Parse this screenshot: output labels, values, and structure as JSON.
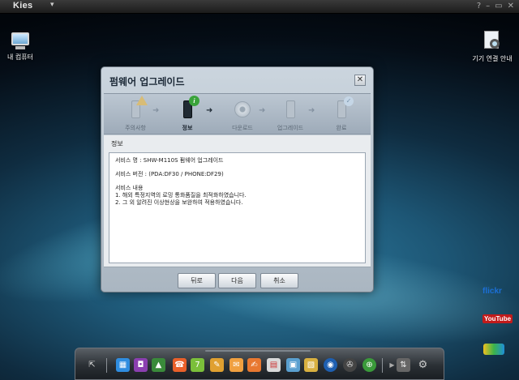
{
  "app": {
    "title": "Kies",
    "menu_glyph": "▾",
    "window_buttons": {
      "help": "?",
      "minimize": "–",
      "restore": "▭",
      "close": "✕"
    }
  },
  "desktop": {
    "my_computer_label": "내 컴퓨터",
    "device_guide_label": "기기 연결 안내"
  },
  "dialog": {
    "title": "펌웨어 업그레이드",
    "close_glyph": "✕",
    "steps": [
      {
        "label": "주의사항",
        "state": "done"
      },
      {
        "label": "정보",
        "state": "active"
      },
      {
        "label": "다운로드",
        "state": "pending"
      },
      {
        "label": "업그레이드",
        "state": "pending"
      },
      {
        "label": "완료",
        "state": "pending"
      }
    ],
    "info_label": "정보",
    "content": {
      "line1": "서비스 명  : SHW-M110S 펌웨어 업그레이드",
      "line2": "서비스 버전  : (PDA:DF30 / PHONE:DF29)",
      "line3": "서비스 내용",
      "line4": "1. 해외 특정지역의  로밍 통화품질을 최적화하였습니다.",
      "line5": "2. 그 외 알려진 이상현상을 보완하여 적용하였습니다."
    },
    "buttons": {
      "back": "뒤로",
      "next": "다음",
      "cancel": "취소"
    }
  },
  "side_apps": {
    "flickr": "flickr",
    "youtube": "YouTube",
    "other": "other"
  },
  "colors": {
    "accent_green": "#3aa33a",
    "dialog_bg": "#cbd5de"
  }
}
